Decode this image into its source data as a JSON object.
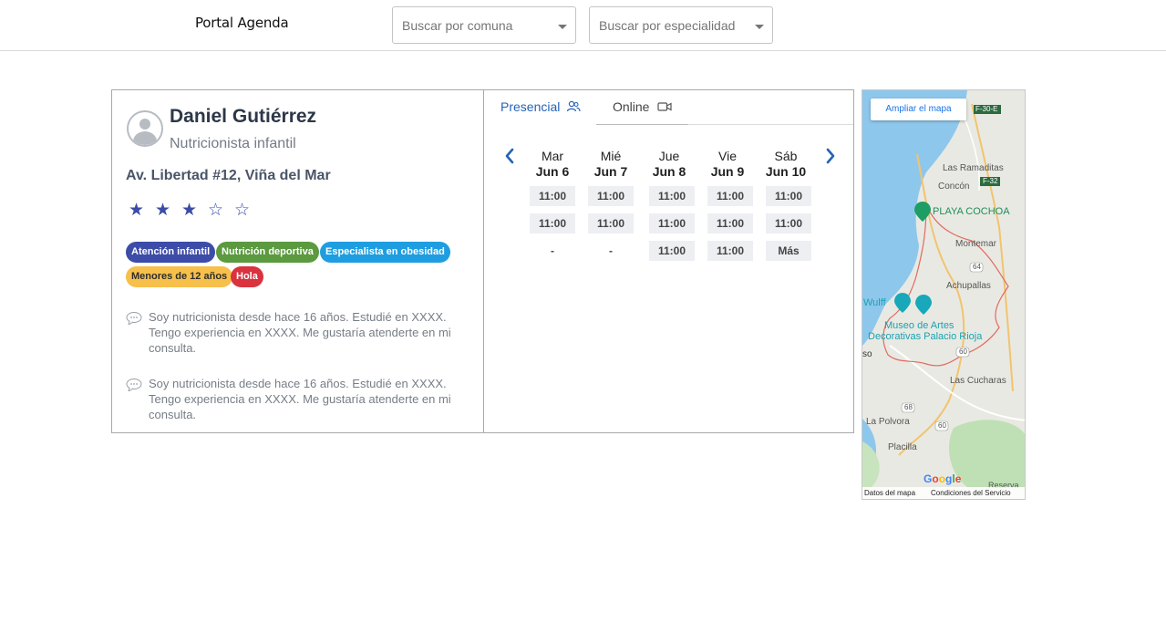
{
  "header": {
    "brand": "Portal Agenda",
    "comuna_placeholder": "Buscar por comuna",
    "especialidad_placeholder": "Buscar por especialidad"
  },
  "doctor": {
    "name": "Daniel Gutiérrez",
    "specialty": "Nutricionista infantil",
    "address": "Av. Libertad #12, Viña del Mar",
    "rating": 3,
    "rating_max": 5,
    "tags": [
      {
        "label": "Atención infantil",
        "bg": "#3c4ca8",
        "fg": "#ffffff"
      },
      {
        "label": "Nutrición deportiva",
        "bg": "#5b9a3f",
        "fg": "#ffffff"
      },
      {
        "label": "Especialista en obesidad",
        "bg": "#1e9ee0",
        "fg": "#ffffff"
      },
      {
        "label": "Menores de 12 años",
        "bg": "#f6c04b",
        "fg": "#2d2d2d"
      },
      {
        "label": "Hola",
        "bg": "#d9333f",
        "fg": "#ffffff"
      }
    ],
    "comments": [
      "Soy nutricionista desde hace 16 años. Estudié en XXXX. Tengo experiencia en XXXX. Me gustaría atenderte en mi consulta.",
      "Soy nutricionista desde hace 16 años. Estudié en XXXX. Tengo experiencia en XXXX. Me gustaría atenderte en mi consulta."
    ]
  },
  "tabs": {
    "presencial": "Presencial",
    "online": "Online"
  },
  "calendar": {
    "days": [
      {
        "name": "Mar",
        "date": "Jun 6",
        "slots": [
          "11:00",
          "11:00",
          "-"
        ]
      },
      {
        "name": "Mié",
        "date": "Jun 7",
        "slots": [
          "11:00",
          "11:00",
          "-"
        ]
      },
      {
        "name": "Jue",
        "date": "Jun 8",
        "slots": [
          "11:00",
          "11:00",
          "11:00"
        ]
      },
      {
        "name": "Vie",
        "date": "Jun 9",
        "slots": [
          "11:00",
          "11:00",
          "11:00"
        ]
      },
      {
        "name": "Sáb",
        "date": "Jun 10",
        "slots": [
          "11:00",
          "11:00",
          "Más"
        ]
      }
    ]
  },
  "map": {
    "expand_button": "Ampliar el mapa",
    "labels": {
      "f30e": "F-30-E",
      "las_ramaditas": "Las Ramaditas",
      "concon": "Concón",
      "f32": "F-32",
      "playa_cochoa": "PLAYA COCHOA",
      "montemar": "Montemar",
      "r64": "64",
      "achupallas": "Achupallas",
      "wulff": "Wulff",
      "museo": "Museo de Artes",
      "decorativas": "Decorativas Palacio Rioja",
      "so": "so",
      "r60": "60",
      "las_cucharas": "Las Cucharas",
      "r68": "68",
      "la_polvora": "La Polvora",
      "r60b": "60",
      "placilla": "Placilla",
      "reserva": "Reserva"
    },
    "google": "Google",
    "footer_data": "Datos del mapa",
    "footer_terms": "Condiciones del Servicio"
  }
}
